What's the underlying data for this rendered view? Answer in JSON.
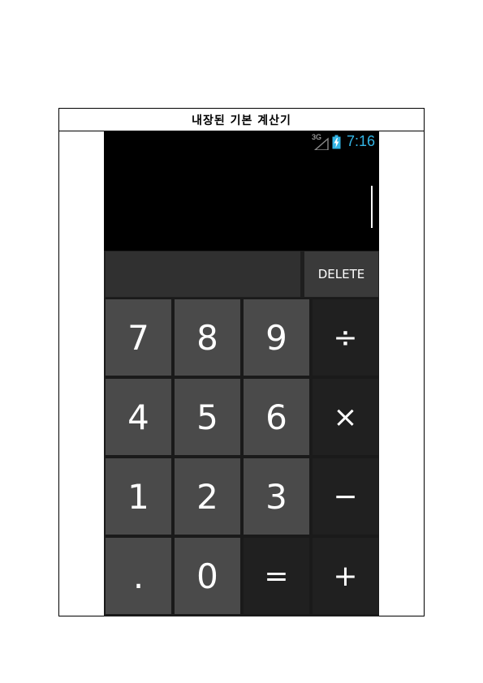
{
  "document": {
    "title": "내장된 기본 계산기"
  },
  "status_bar": {
    "network": "3G",
    "time": "7:16",
    "accent_color": "#33b5e5"
  },
  "display": {
    "value": "",
    "result": ""
  },
  "delete_label": "DELETE",
  "keys": {
    "k7": "7",
    "k8": "8",
    "k9": "9",
    "div": "÷",
    "k4": "4",
    "k5": "5",
    "k6": "6",
    "mul": "×",
    "k1": "1",
    "k2": "2",
    "k3": "3",
    "sub": "−",
    "dot": ".",
    "k0": "0",
    "eq": "=",
    "add": "+"
  }
}
